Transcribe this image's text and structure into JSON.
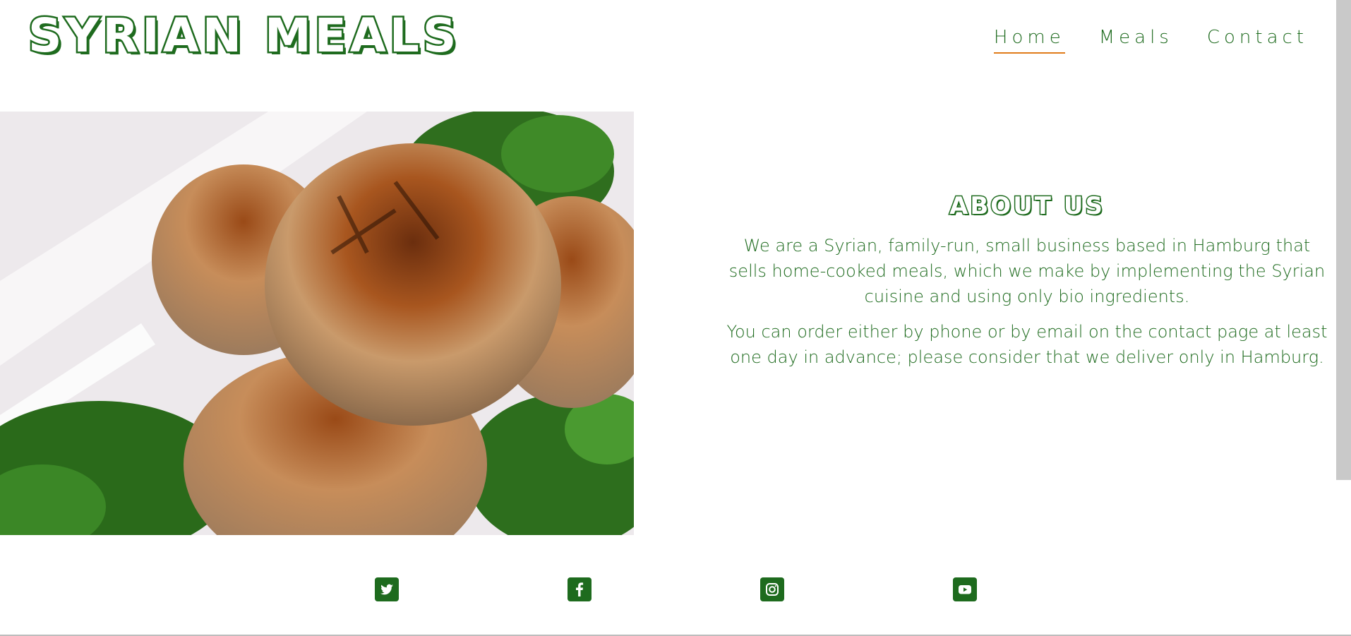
{
  "header": {
    "logo_text": "SYRIAN MEALS",
    "nav": [
      {
        "label": "Home",
        "active": true
      },
      {
        "label": "Meals",
        "active": false
      },
      {
        "label": "Contact",
        "active": false
      }
    ]
  },
  "about": {
    "heading": "ABOUT US",
    "paragraphs": [
      "We are a Syrian, family-run, small business based in Hamburg that sells home-cooked meals, which we make by implementing the Syrian cuisine and using only bio ingredients.",
      "You can order either by phone or by email on the contact page at least one day in advance; please consider that we deliver only in Hamburg."
    ]
  },
  "hero_image": {
    "icon": "food-photo"
  },
  "social": [
    {
      "icon": "twitter-icon"
    },
    {
      "icon": "facebook-icon"
    },
    {
      "icon": "instagram-icon"
    },
    {
      "icon": "youtube-icon"
    }
  ],
  "colors": {
    "brand_green": "#1e6b1e",
    "accent_orange": "#e07b1a"
  }
}
